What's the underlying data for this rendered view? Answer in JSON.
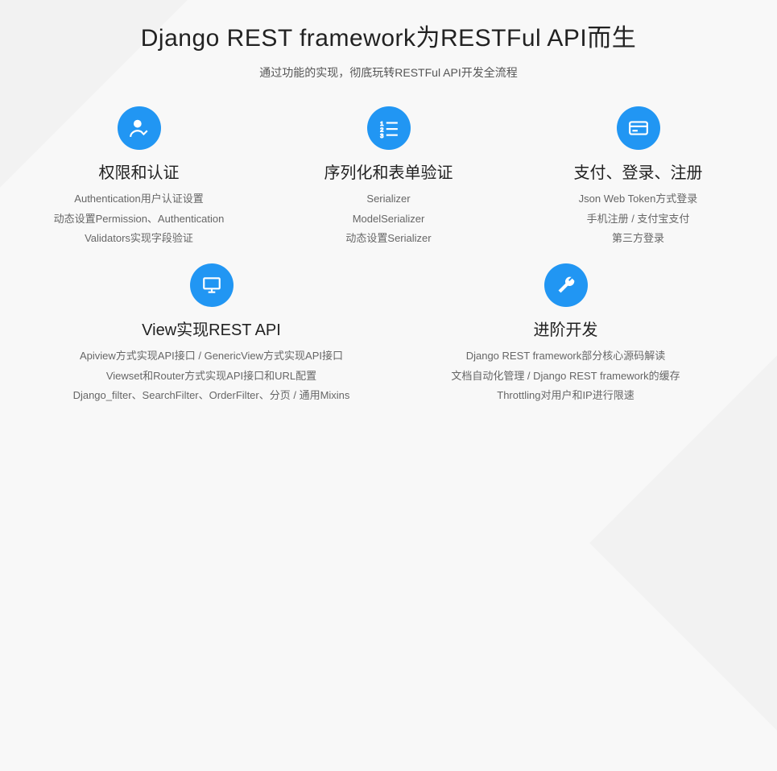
{
  "header": {
    "title": "Django REST framework为RESTFul API而生",
    "subtitle": "通过功能的实现，彻底玩转RESTFul API开发全流程"
  },
  "features": [
    {
      "title": "权限和认证",
      "lines": [
        "Authentication用户认证设置",
        "动态设置Permission、Authentication",
        "Validators实现字段验证"
      ]
    },
    {
      "title": "序列化和表单验证",
      "lines": [
        "Serializer",
        "ModelSerializer",
        "动态设置Serializer"
      ]
    },
    {
      "title": "支付、登录、注册",
      "lines": [
        "Json Web Token方式登录",
        "手机注册 / 支付宝支付",
        "第三方登录"
      ]
    },
    {
      "title": "View实现REST API",
      "lines": [
        "Apiview方式实现API接口 / GenericView方式实现API接口",
        "Viewset和Router方式实现API接口和URL配置",
        "Django_filter、SearchFilter、OrderFilter、分页 / 通用Mixins"
      ]
    },
    {
      "title": "进阶开发",
      "lines": [
        "Django REST framework部分核心源码解读",
        "文档自动化管理 / Django REST framework的缓存",
        "Throttling对用户和IP进行限速"
      ]
    }
  ]
}
